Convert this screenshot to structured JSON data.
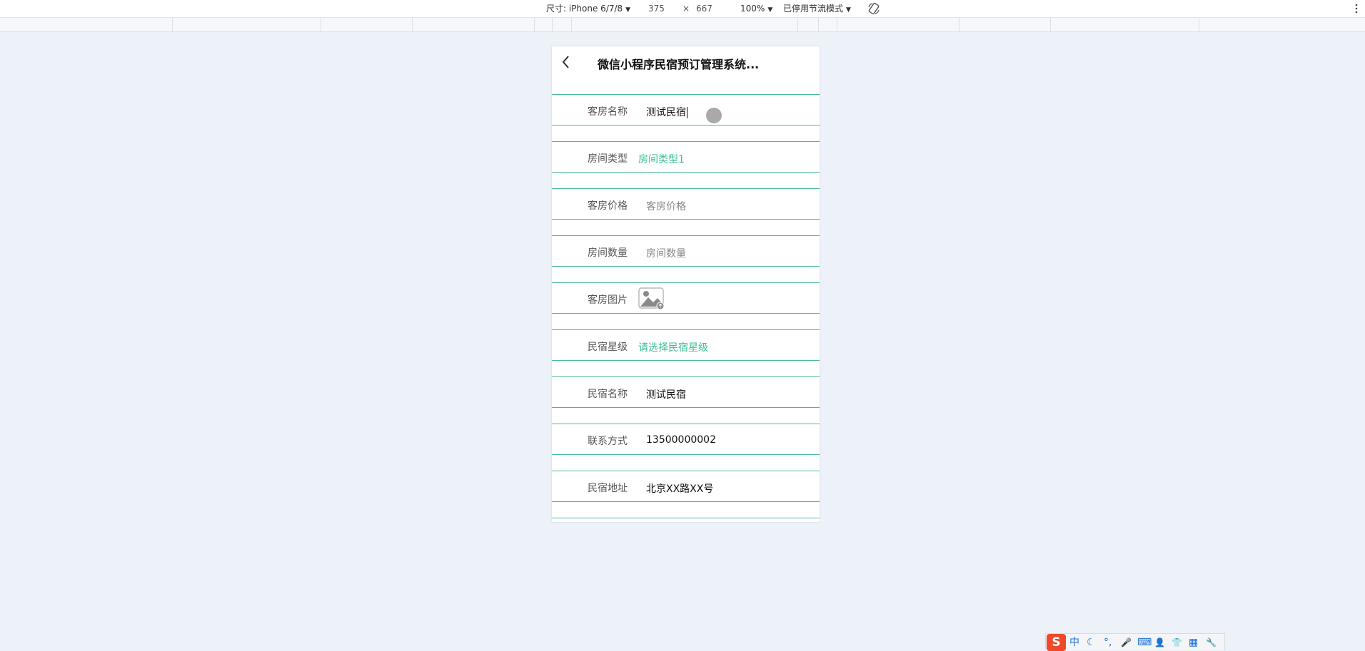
{
  "devtools": {
    "device_label": "尺寸: iPhone 6/7/8",
    "width_value": "375",
    "times": "×",
    "height_value": "667",
    "zoom": "100%",
    "throttle": "已停用节流模式"
  },
  "phone": {
    "nav_title": "微信小程序民宿预订管理系统...",
    "fields": [
      {
        "label": "客房名称",
        "value": "测试民宿"
      },
      {
        "label": "房间类型",
        "value": "房间类型1"
      },
      {
        "label": "客房价格",
        "placeholder": "客房价格"
      },
      {
        "label": "房间数量",
        "placeholder": "房间数量"
      },
      {
        "label": "客房图片"
      },
      {
        "label": "民宿星级",
        "value": "请选择民宿星级"
      },
      {
        "label": "民宿名称",
        "value": "测试民宿"
      },
      {
        "label": "联系方式",
        "value": "13500000002"
      },
      {
        "label": "民宿地址",
        "value": "北京XX路XX号"
      }
    ]
  },
  "ime": {
    "logo": "S",
    "mode": "中",
    "moon": "☾",
    "punct": "°,",
    "mic": "🎤",
    "keyboard": "⌨",
    "user": "👤",
    "shirt": "👕",
    "grid": "▦",
    "tool": "🔧"
  },
  "colors": {
    "accent": "#3bbf98",
    "divider": "#4ab99a",
    "background": "#edf1f8"
  }
}
